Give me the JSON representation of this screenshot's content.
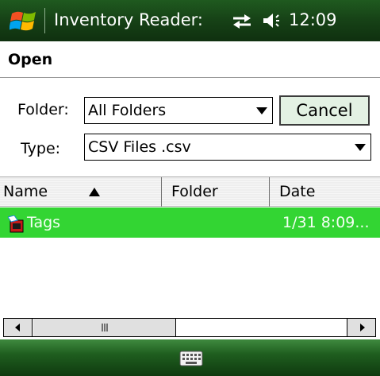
{
  "titlebar": {
    "app_title": "Inventory Reader:",
    "clock": "12:09",
    "icons": [
      "start-flag-icon",
      "connectivity-icon",
      "volume-icon"
    ]
  },
  "header": {
    "title": "Open"
  },
  "form": {
    "folder_label": "Folder:",
    "folder_value": "All Folders",
    "type_label": "Type:",
    "type_value": "CSV Files .csv",
    "cancel_label": "Cancel"
  },
  "list": {
    "columns": [
      "Name",
      "Folder",
      "Date"
    ],
    "sort_column": "Name",
    "rows": [
      {
        "name": "Tags",
        "folder": "",
        "date": "1/31 8:09...",
        "selected": true,
        "icon": "file-icon"
      }
    ]
  },
  "scrollbar": {
    "icons": [
      "scroll-left-icon",
      "scroll-right-icon"
    ]
  },
  "menubar": {
    "icons": [
      "keyboard-icon"
    ]
  },
  "colors": {
    "titlebar": "#174317",
    "selection": "#33d533",
    "cancel_bg": "#e3f1e3"
  }
}
